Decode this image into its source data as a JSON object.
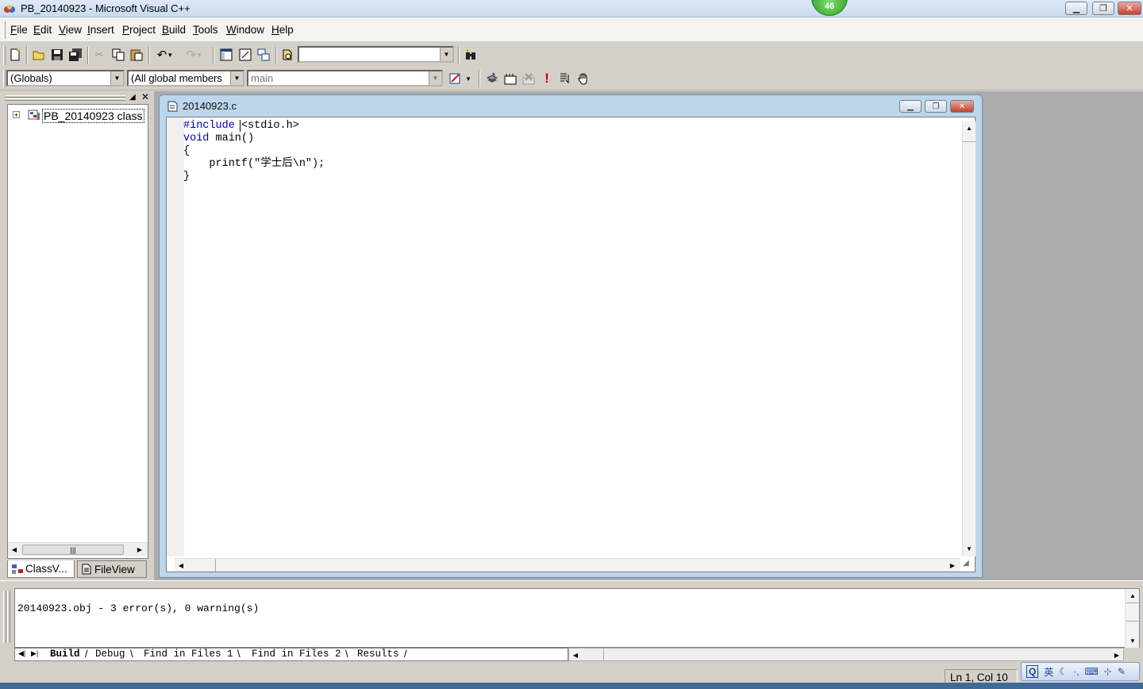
{
  "window": {
    "title": "PB_20140923 - Microsoft Visual C++",
    "badge": "46"
  },
  "menu": [
    "File",
    "Edit",
    "View",
    "Insert",
    "Project",
    "Build",
    "Tools",
    "Window",
    "Help"
  ],
  "toolbar": {
    "find_value": ""
  },
  "wizardbar": {
    "class_combo": "(Globals)",
    "filter_combo": "(All global members",
    "member_combo": "main"
  },
  "workspace": {
    "tree_root": "PB_20140923 class",
    "tabs": {
      "classview": "ClassV...",
      "fileview": "FileView"
    }
  },
  "editor": {
    "title": "20140923.c",
    "code_lines": [
      {
        "kw": "#include",
        "rest": " <stdio.h>"
      },
      {
        "kw": "void",
        "rest": " main()"
      },
      {
        "kw": "",
        "rest": "{"
      },
      {
        "kw": "",
        "rest": "    printf(\"学士后\\n\");"
      },
      {
        "kw": "",
        "rest": "}"
      }
    ]
  },
  "output": {
    "message": "20140923.obj - 3 error(s), 0 warning(s)",
    "tabs": [
      "Build",
      "Debug",
      "Find in Files 1",
      "Find in Files 2",
      "Results"
    ]
  },
  "status": {
    "position": "Ln 1, Col 10"
  },
  "ime": {
    "mode": "英"
  },
  "colors": {
    "keyword": "#0000c0",
    "titlebar": "#c9daee",
    "mdi_background": "#ababab"
  }
}
